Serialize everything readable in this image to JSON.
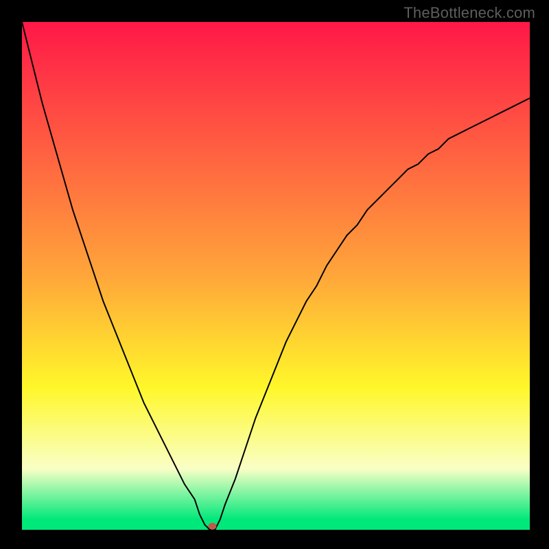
{
  "watermark": "TheBottleneck.com",
  "colors": {
    "red_top": "#ff1848",
    "orange": "#ffa63a",
    "yellow": "#fff72a",
    "pale": "#f9ffc6",
    "green": "#00e87a",
    "curve": "#000000",
    "marker": "#bf5a4a"
  },
  "chart_data": {
    "type": "line",
    "title": "",
    "xlabel": "",
    "ylabel": "",
    "xlim": [
      0,
      100
    ],
    "ylim": [
      0,
      100
    ],
    "x": [
      0,
      2,
      4,
      6,
      8,
      10,
      12,
      14,
      16,
      18,
      20,
      22,
      24,
      26,
      28,
      30,
      32,
      34,
      35,
      36,
      37,
      38,
      39,
      40,
      42,
      44,
      46,
      48,
      50,
      52,
      54,
      56,
      58,
      60,
      62,
      64,
      66,
      68,
      70,
      72,
      74,
      76,
      78,
      80,
      82,
      84,
      86,
      88,
      90,
      92,
      94,
      96,
      98,
      100
    ],
    "y": [
      100,
      92,
      84,
      77,
      70,
      63,
      57,
      51,
      45,
      40,
      35,
      30,
      25,
      21,
      17,
      13,
      9,
      6,
      3,
      1,
      0,
      0,
      2,
      5,
      10,
      16,
      22,
      27,
      32,
      37,
      41,
      45,
      48,
      52,
      55,
      58,
      60,
      63,
      65,
      67,
      69,
      71,
      72,
      74,
      75,
      77,
      78,
      79,
      80,
      81,
      82,
      83,
      84,
      85
    ],
    "marker": {
      "x": 37.5,
      "y": 0.7
    },
    "gradient_stops": [
      {
        "pct": 0,
        "c": "red_top"
      },
      {
        "pct": 50,
        "c": "orange"
      },
      {
        "pct": 72,
        "c": "yellow"
      },
      {
        "pct": 88,
        "c": "pale"
      },
      {
        "pct": 98,
        "c": "green"
      },
      {
        "pct": 100,
        "c": "green"
      }
    ]
  }
}
